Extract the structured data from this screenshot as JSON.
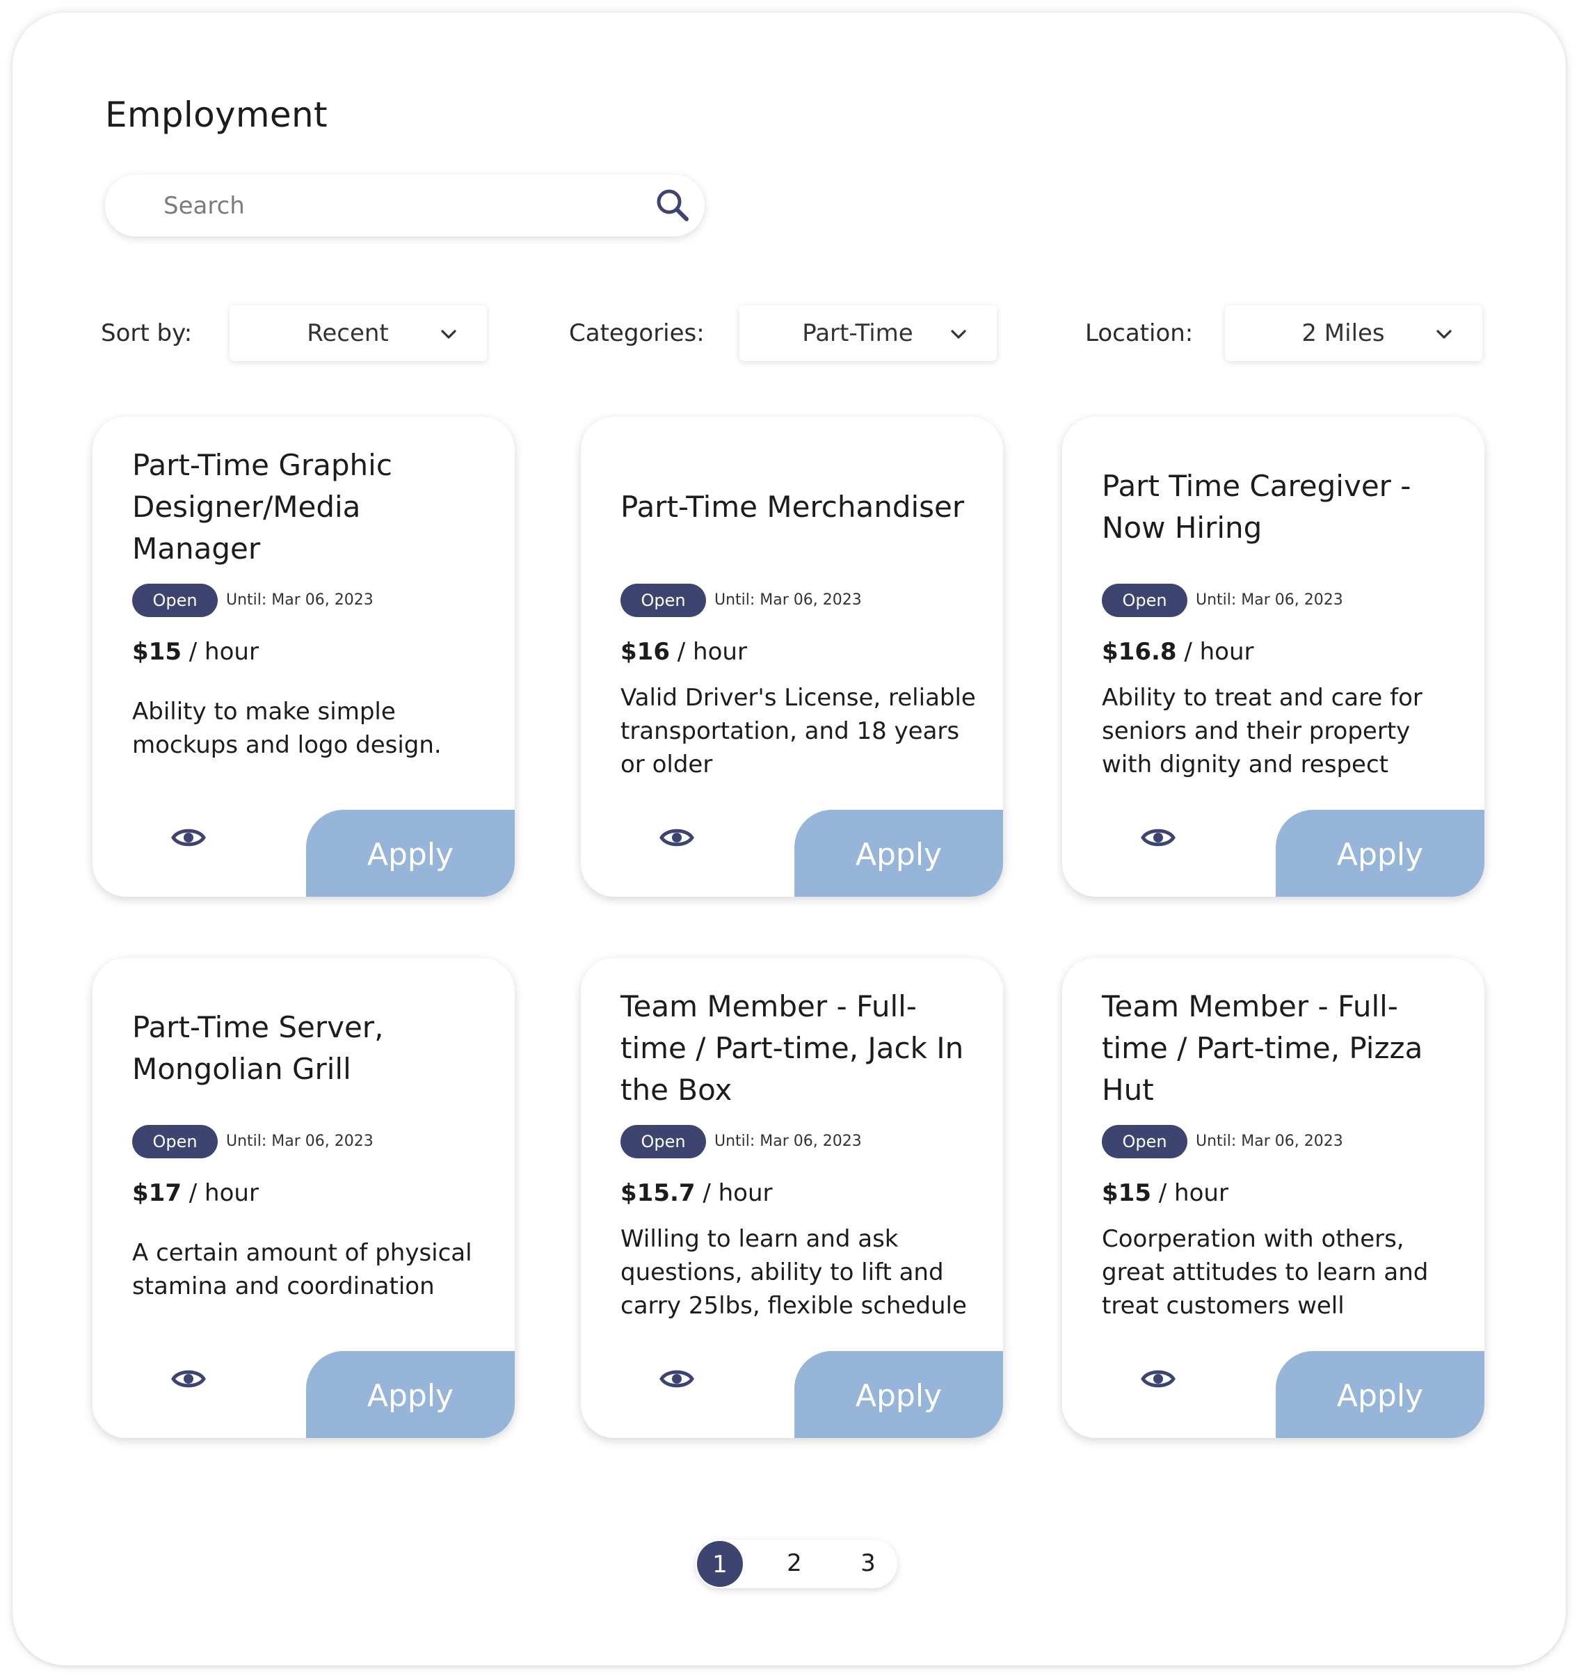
{
  "page": {
    "title": "Employment"
  },
  "search": {
    "placeholder": "Search"
  },
  "filters": {
    "sort": {
      "label": "Sort by:",
      "value": "Recent"
    },
    "categories": {
      "label": "Categories:",
      "value": "Part-Time"
    },
    "location": {
      "label": "Location:",
      "value": "2 Miles"
    }
  },
  "jobs": [
    {
      "title": "Part-Time Graphic Designer/Media Manager",
      "status": "Open",
      "until": "Until: Mar 06, 2023",
      "pay": "$15",
      "pay_unit": " / hour",
      "description": "Ability to make simple mockups and logo design.",
      "apply_label": "Apply"
    },
    {
      "title": "Part-Time Merchandiser",
      "status": "Open",
      "until": "Until: Mar 06, 2023",
      "pay": "$16",
      "pay_unit": " / hour",
      "description": "Valid Driver's License, reliable transportation, and 18 years or older",
      "apply_label": "Apply"
    },
    {
      "title": "Part Time Caregiver - Now Hiring",
      "status": "Open",
      "until": "Until: Mar 06, 2023",
      "pay": "$16.8",
      "pay_unit": " / hour",
      "description": "Ability to treat and care for seniors and their property with dignity and respect",
      "apply_label": "Apply"
    },
    {
      "title": "Part-Time Server, Mongolian Grill",
      "status": "Open",
      "until": "Until: Mar 06, 2023",
      "pay": "$17",
      "pay_unit": " / hour",
      "description": "A certain amount of physical stamina and coordination",
      "apply_label": "Apply"
    },
    {
      "title": "Team Member - Full-time / Part-time, Jack In the Box",
      "status": "Open",
      "until": "Until: Mar 06, 2023",
      "pay": "$15.7",
      "pay_unit": " / hour",
      "description": "Willing to learn and ask questions, ability to lift and carry 25lbs, flexible schedule",
      "apply_label": "Apply"
    },
    {
      "title": "Team Member - Full-time / Part-time, Pizza Hut",
      "status": "Open",
      "until": "Until: Mar 06, 2023",
      "pay": "$15",
      "pay_unit": " / hour",
      "description": "Coorperation with others, great attitudes to learn and treat customers well",
      "apply_label": "Apply"
    }
  ],
  "pagination": {
    "pages": [
      "1",
      "2",
      "3"
    ],
    "current": "1"
  },
  "colors": {
    "accent_dark": "#3e4470",
    "apply_blue": "#96b5d8"
  },
  "icons": {
    "search": "search-icon",
    "view": "eye-icon",
    "dropdown": "chevron-down-icon"
  }
}
